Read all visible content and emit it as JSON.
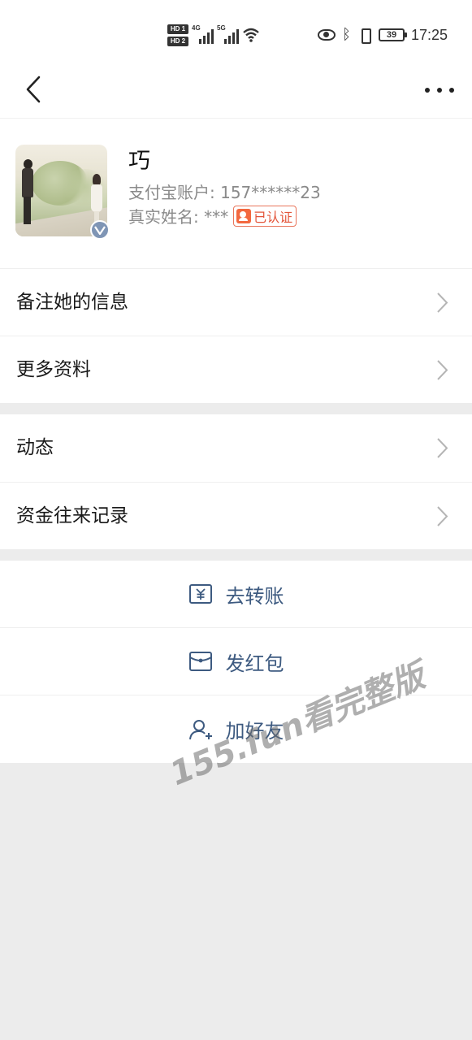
{
  "status_bar": {
    "sim1": "HD 1",
    "sim2": "HD 2",
    "net1": "4G",
    "net2": "5G",
    "battery": "39",
    "time": "17:25"
  },
  "profile": {
    "name": "巧",
    "account_label": "支付宝账户: 157******23",
    "real_name_label": "真实姓名: ***",
    "verified_label": "已认证"
  },
  "menu_group_1": [
    {
      "label": "备注她的信息"
    },
    {
      "label": "更多资料"
    }
  ],
  "menu_group_2": [
    {
      "label": "动态"
    },
    {
      "label": "资金往来记录"
    }
  ],
  "actions": [
    {
      "label": "去转账",
      "icon": "transfer-yuan-icon"
    },
    {
      "label": "发红包",
      "icon": "red-packet-icon"
    },
    {
      "label": "加好友",
      "icon": "add-friend-icon"
    }
  ],
  "watermark": "155.fun看完整版",
  "colors": {
    "accent": "#3d5a80",
    "verified": "#e3553a",
    "background": "#ececec"
  }
}
